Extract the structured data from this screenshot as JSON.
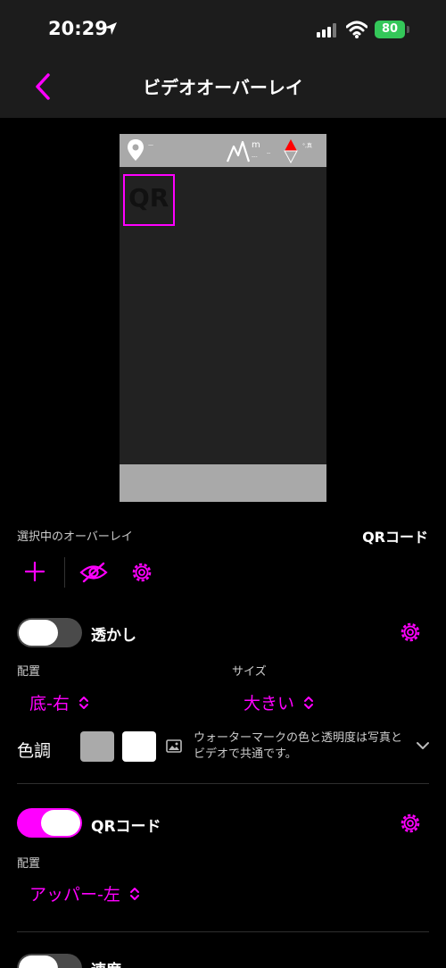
{
  "status_bar": {
    "time": "20:29",
    "battery": "80"
  },
  "nav": {
    "title": "ビデオオーバーレイ"
  },
  "preview": {
    "qr_text": "QR",
    "alt_unit": "m",
    "compass_label": "°,真"
  },
  "selected": {
    "label": "選択中のオーバーレイ",
    "value": "QRコード"
  },
  "watermark": {
    "label": "透かし",
    "enabled": false,
    "placement_label": "配置",
    "placement_value": "底-右",
    "size_label": "サイズ",
    "size_value": "大きい",
    "tone_label": "色調",
    "tone_note": "ウォーターマークの色と透明度は写真とビデオで共通です。",
    "colors": [
      "#aaaaaa",
      "#ffffff"
    ]
  },
  "qr": {
    "label": "QRコード",
    "enabled": true,
    "placement_label": "配置",
    "placement_value": "アッパー-左"
  },
  "speed": {
    "label": "速度",
    "enabled": false
  },
  "colors": {
    "accent": "#ff00ff",
    "battery": "#34c759"
  }
}
